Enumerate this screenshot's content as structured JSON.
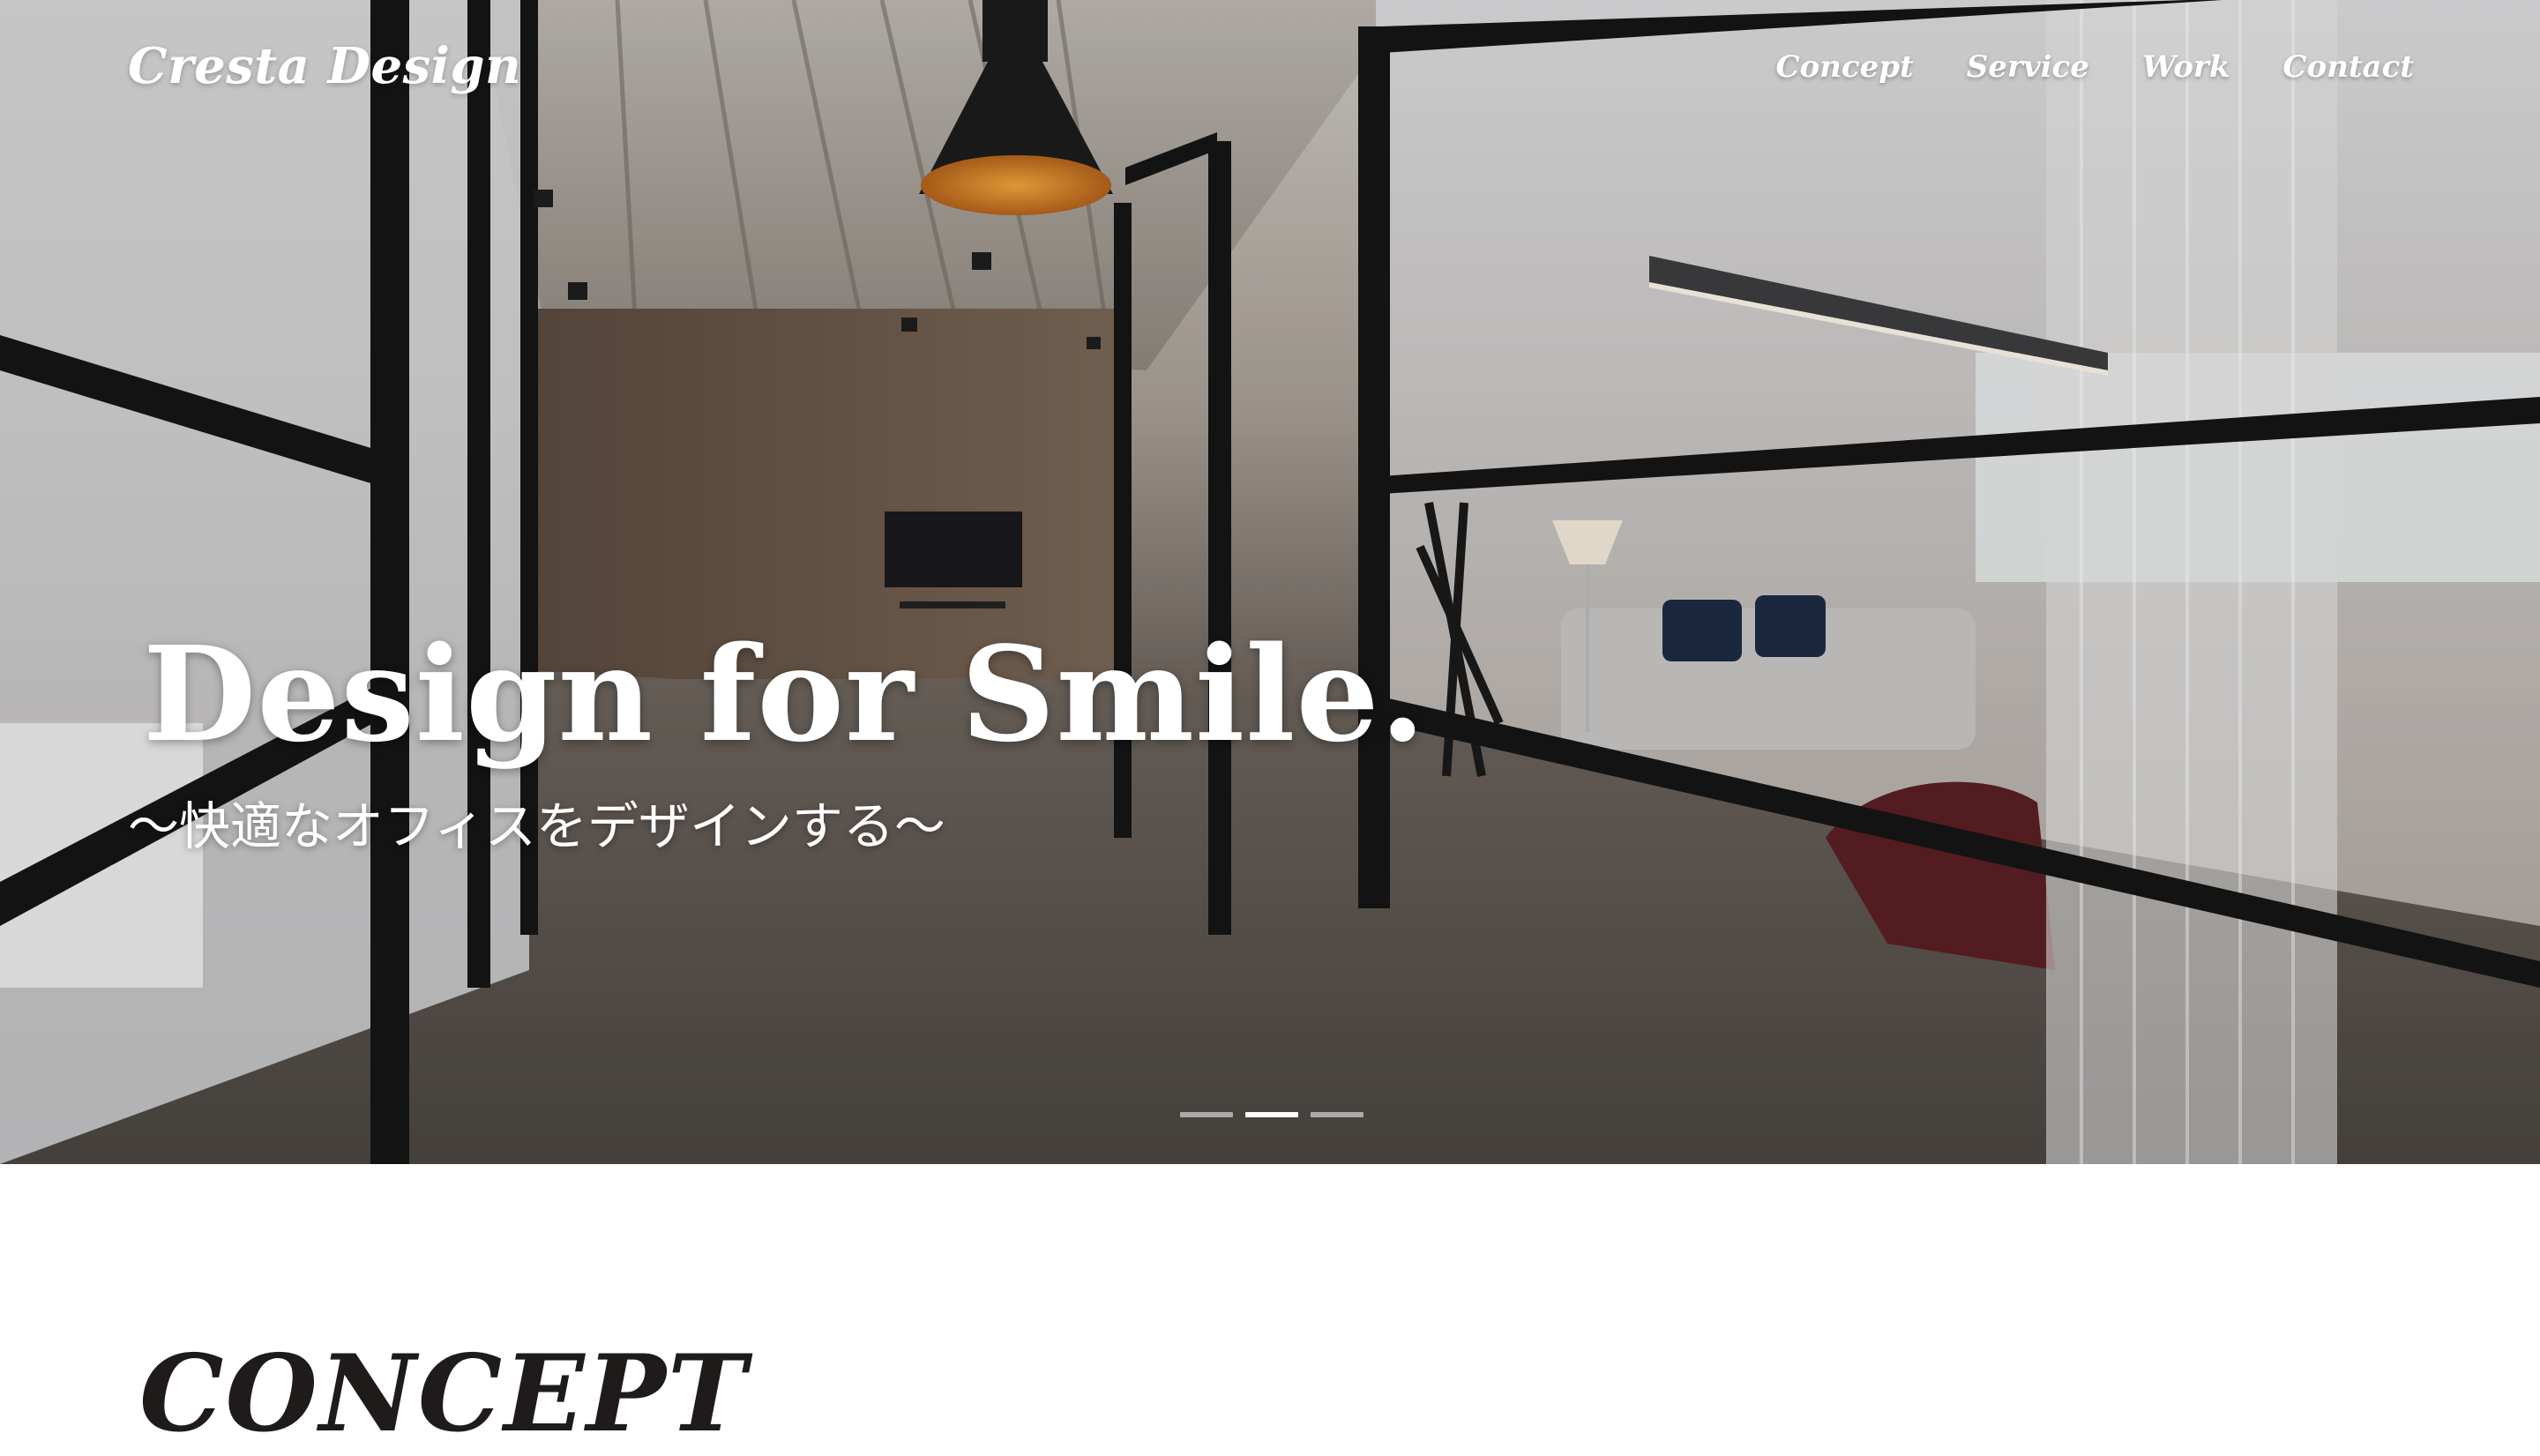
{
  "header": {
    "logo": "Cresta Design",
    "nav": [
      {
        "label": "Concept"
      },
      {
        "label": "Service"
      },
      {
        "label": "Work"
      },
      {
        "label": "Contact"
      }
    ]
  },
  "hero": {
    "headline": "Design for Smile.",
    "subheadline": "〜快適なオフィスをデザインする〜",
    "slider": {
      "slides": 3,
      "active_index": 1
    }
  },
  "concept": {
    "title": "CONCEPT"
  },
  "colors": {
    "text_light": "#ffffff",
    "text_dark": "#1f1b1b",
    "background": "#ffffff"
  }
}
